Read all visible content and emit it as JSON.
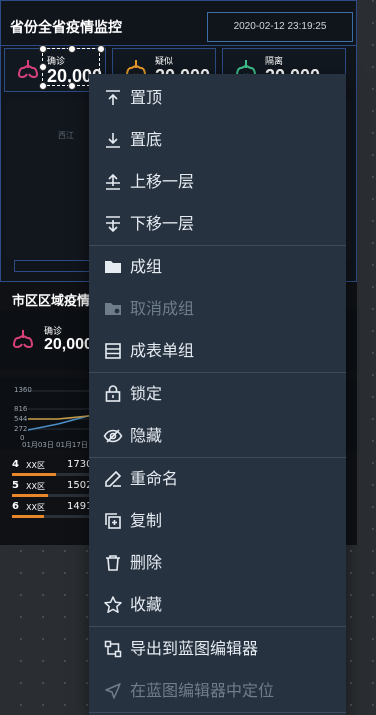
{
  "dashboard": {
    "title": "省份全省疫情监控",
    "date": "2020-02-12 23:19:25",
    "stats": [
      {
        "label": "确诊",
        "value": "20,000",
        "color": "#d8407b"
      },
      {
        "label": "疑似",
        "value": "20,000",
        "color": "#e89a2a"
      },
      {
        "label": "隔离",
        "value": "20,000",
        "color": "#3ec38c"
      }
    ],
    "map_label": "西江",
    "section2_title": "市区区域疫情",
    "mid_stat": {
      "label": "确诊",
      "value": "20,000"
    },
    "chart": {
      "yticks": [
        "1360",
        "816",
        "544",
        "272",
        "0"
      ],
      "xticks": [
        "01月03日",
        "01月17日"
      ]
    },
    "ranking": [
      {
        "num": "4",
        "name": "XX区",
        "value": "1730",
        "fill": 0.55
      },
      {
        "num": "5",
        "name": "XX区",
        "value": "1502",
        "fill": 0.45
      },
      {
        "num": "6",
        "name": "XX区",
        "value": "1491",
        "fill": 0.4
      }
    ]
  },
  "context_menu": {
    "items": [
      {
        "label": "置顶",
        "icon": "bring-to-top-icon",
        "enabled": true
      },
      {
        "label": "置底",
        "icon": "send-to-bottom-icon",
        "enabled": true
      },
      {
        "label": "上移一层",
        "icon": "move-up-icon",
        "enabled": true
      },
      {
        "label": "下移一层",
        "icon": "move-down-icon",
        "enabled": true
      },
      {
        "label": "成组",
        "icon": "folder-icon",
        "enabled": true
      },
      {
        "label": "取消成组",
        "icon": "ungroup-folder-icon",
        "enabled": false
      },
      {
        "label": "成表单组",
        "icon": "form-group-icon",
        "enabled": true
      },
      {
        "label": "锁定",
        "icon": "lock-icon",
        "enabled": true
      },
      {
        "label": "隐藏",
        "icon": "hide-eye-icon",
        "enabled": true
      },
      {
        "label": "重命名",
        "icon": "rename-pencil-icon",
        "enabled": true
      },
      {
        "label": "复制",
        "icon": "copy-icon",
        "enabled": true
      },
      {
        "label": "删除",
        "icon": "trash-icon",
        "enabled": true
      },
      {
        "label": "收藏",
        "icon": "star-icon",
        "enabled": true
      },
      {
        "label": "导出到蓝图编辑器",
        "icon": "export-blueprint-icon",
        "enabled": true
      },
      {
        "label": "在蓝图编辑器中定位",
        "icon": "locate-arrow-icon",
        "enabled": false
      }
    ]
  }
}
